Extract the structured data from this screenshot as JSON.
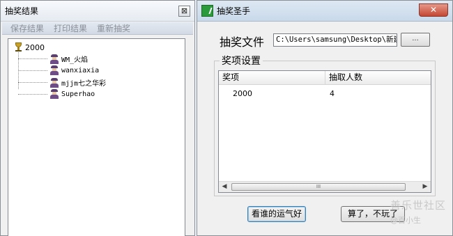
{
  "left_window": {
    "title": "抽奖结果",
    "close_glyph": "⊠",
    "menu": [
      "保存结果",
      "打印结果",
      "重新抽奖"
    ],
    "tree": {
      "root": "2000",
      "children": [
        "WM_火焰",
        "wanxiaxia",
        "mjjm七之华彩",
        "Superhao"
      ]
    }
  },
  "right_window": {
    "title": "抽奖圣手",
    "close_glyph": "✕",
    "file_label": "抽奖文件",
    "file_path": "C:\\Users\\samsung\\Desktop\\新建",
    "browse_label": "...",
    "group_title": "奖项设置",
    "table": {
      "headers": [
        "奖项",
        "抽取人数"
      ],
      "rows": [
        [
          "2000",
          "4"
        ]
      ]
    },
    "scroll_left": "◀",
    "scroll_right": "▶",
    "scroll_grip": "III",
    "buttons": {
      "luck": "看谁的运气好",
      "quit": "算了，不玩了"
    }
  },
  "watermark": {
    "main": "善乐世社区",
    "sub": "@百小生"
  },
  "colors": {
    "close_red": "#c44733",
    "app_icon_green": "#2a9a3a",
    "menu_disabled": "#8a8f98"
  }
}
